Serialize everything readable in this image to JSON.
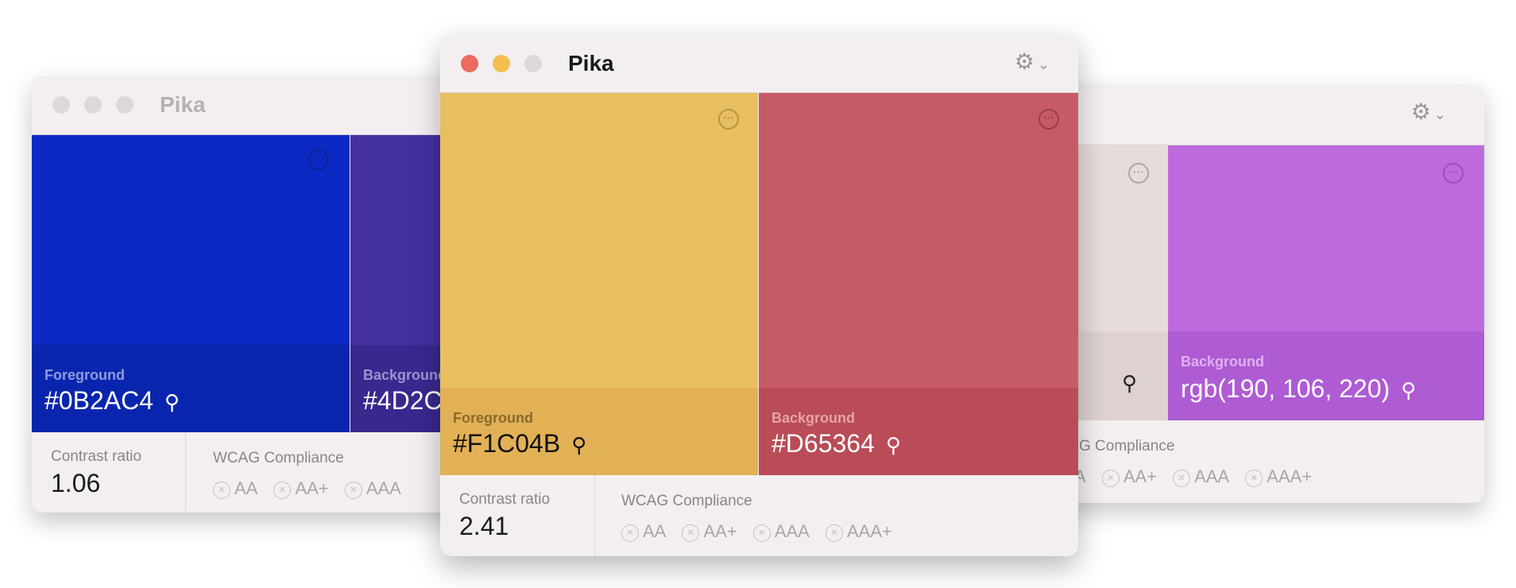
{
  "windows": {
    "left": {
      "title": "Pika",
      "foreground": {
        "label": "Foreground",
        "value": "#0B2AC4",
        "color": "#0B2AC4",
        "panel": "#0a25ad"
      },
      "background": {
        "label": "Background",
        "value": "#4D2C",
        "color": "#4530a2",
        "panel": "#3a288f"
      },
      "contrast_label": "Contrast ratio",
      "contrast": "1.06",
      "wcag_label": "WCAG Compliance",
      "badges": [
        "AA",
        "AA+",
        "AAA"
      ]
    },
    "center": {
      "title": "Pika",
      "foreground": {
        "label": "Foreground",
        "value": "#F1C04B",
        "color": "#e8bf60",
        "panel": "#e2b156"
      },
      "background": {
        "label": "Background",
        "value": "#D65364",
        "color": "#c65b66",
        "panel": "#b94c57"
      },
      "contrast_label": "Contrast ratio",
      "contrast": "2.41",
      "wcag_label": "WCAG Compliance",
      "badges": [
        "AA",
        "AA+",
        "AAA",
        "AAA+"
      ]
    },
    "right": {
      "foreground": {
        "color": "#e6dcda",
        "panel": "#ddd2d0"
      },
      "background": {
        "label": "Background",
        "value": "rgb(190, 106, 220)",
        "color": "#be6adc",
        "panel": "#ae5bd4"
      },
      "wcag_label": "G Compliance",
      "badges": [
        "A",
        "AA+",
        "AAA",
        "AAA+"
      ]
    }
  },
  "icons": {
    "more": "ellipsis-circle-icon",
    "eyedropper": "eyedropper-icon",
    "gear": "gear-icon",
    "fail": "x-circle-icon"
  }
}
